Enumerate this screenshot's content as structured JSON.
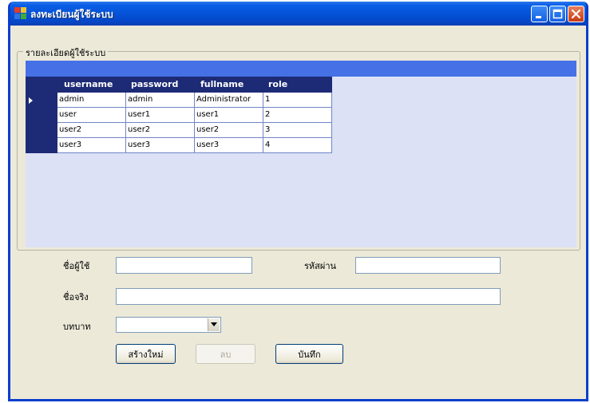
{
  "window": {
    "title": "ลงทะเบียนผู้ใช้ระบบ"
  },
  "group": {
    "legend": "รายละเอียดผู้ใช้ระบบ"
  },
  "grid": {
    "columns": [
      "username",
      "password",
      "fullname",
      "role"
    ],
    "selected_row": 0,
    "rows": [
      [
        "admin",
        "admin",
        "Administrator",
        "1"
      ],
      [
        "user",
        "user1",
        "user1",
        "2"
      ],
      [
        "user2",
        "user2",
        "user2",
        "3"
      ],
      [
        "user3",
        "user3",
        "user3",
        "4"
      ]
    ]
  },
  "form": {
    "username_label": "ชื่อผู้ใช้",
    "username_value": "",
    "password_label": "รหัสผ่าน",
    "password_value": "",
    "fullname_label": "ชื่อจริง",
    "fullname_value": "",
    "role_label": "บทบาท",
    "role_value": ""
  },
  "buttons": {
    "new_label": "สร้างใหม่",
    "delete_label": "ลบ",
    "save_label": "บันทึก"
  },
  "colors": {
    "titlebar": "#0553d8",
    "grid_header": "#1d2a75",
    "grid_strip": "#4570e6",
    "grid_background": "#dce1f6",
    "window_face": "#ece9d8"
  },
  "icons": {
    "app": "app-window-icon",
    "minimize": "minimize-icon",
    "maximize": "maximize-icon",
    "close": "close-icon",
    "row_selector": "row-selector-arrow-icon",
    "dropdown": "chevron-down-icon"
  }
}
